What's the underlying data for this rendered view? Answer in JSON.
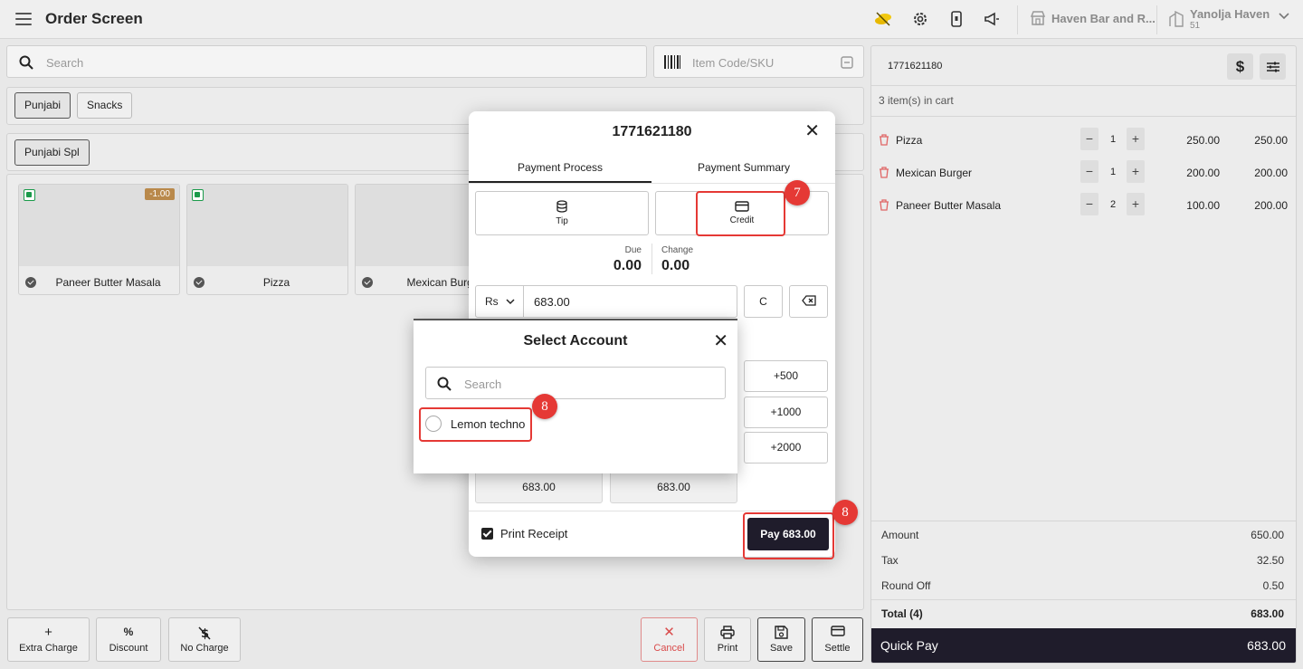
{
  "app": {
    "title": "Order Screen"
  },
  "topbar": {
    "store_name": "Haven Bar and R...",
    "tenant_name": "Yanolja Haven",
    "tenant_sub": "51"
  },
  "search": {
    "placeholder": "Search",
    "sku_placeholder": "Item Code/SKU"
  },
  "categories": [
    "Punjabi",
    "Snacks"
  ],
  "subcategories": [
    "Punjabi Spl"
  ],
  "items": [
    {
      "name": "Paneer Butter Masala",
      "badge": "-1.00"
    },
    {
      "name": "Pizza",
      "badge": ""
    },
    {
      "name": "Mexican Burger",
      "badge": ""
    }
  ],
  "actions": {
    "extra_charge": "Extra Charge",
    "discount": "Discount",
    "discount_icon": "%",
    "no_charge": "No Charge",
    "cancel": "Cancel",
    "print": "Print",
    "save": "Save",
    "settle": "Settle"
  },
  "cart": {
    "order_no": "1771621180",
    "count_text": "3 item(s) in cart",
    "rows": [
      {
        "name": "Pizza",
        "qty": "1",
        "price": "250.00",
        "total": "250.00"
      },
      {
        "name": "Mexican Burger",
        "qty": "1",
        "price": "200.00",
        "total": "200.00"
      },
      {
        "name": "Paneer Butter Masala",
        "qty": "2",
        "price": "100.00",
        "total": "200.00"
      }
    ],
    "summary": {
      "amount_label": "Amount",
      "amount": "650.00",
      "tax_label": "Tax",
      "tax": "32.50",
      "roundoff_label": "Round Off",
      "roundoff": "0.50",
      "total_label": "Total (4)",
      "total": "683.00"
    },
    "quickpay_label": "Quick Pay",
    "quickpay_amount": "683.00"
  },
  "payment_modal": {
    "title": "1771621180",
    "tabs": [
      "Payment Process",
      "Payment Summary"
    ],
    "methods": {
      "tip": "Tip",
      "credit": "Credit"
    },
    "due_label": "Due",
    "due": "0.00",
    "change_label": "Change",
    "change": "0.00",
    "currency": "Rs",
    "amount": "683.00",
    "clear_label": "C",
    "quick_add": [
      "+500",
      "+1000",
      "+2000"
    ],
    "quick_amounts": [
      "683.00",
      "683.00"
    ],
    "print_receipt": "Print Receipt",
    "pay_label": "Pay 683.00"
  },
  "select_account": {
    "title": "Select Account",
    "search_placeholder": "Search",
    "options": [
      "Lemon techno"
    ]
  },
  "annotations": {
    "marker_credit": "7",
    "marker_account": "8",
    "marker_pay": "8"
  },
  "colors": {
    "accent_dark": "#1f1c2b",
    "annotation_red": "#e53935",
    "veg_green": "#1a9a4a",
    "badge_brown": "#b9894b"
  }
}
